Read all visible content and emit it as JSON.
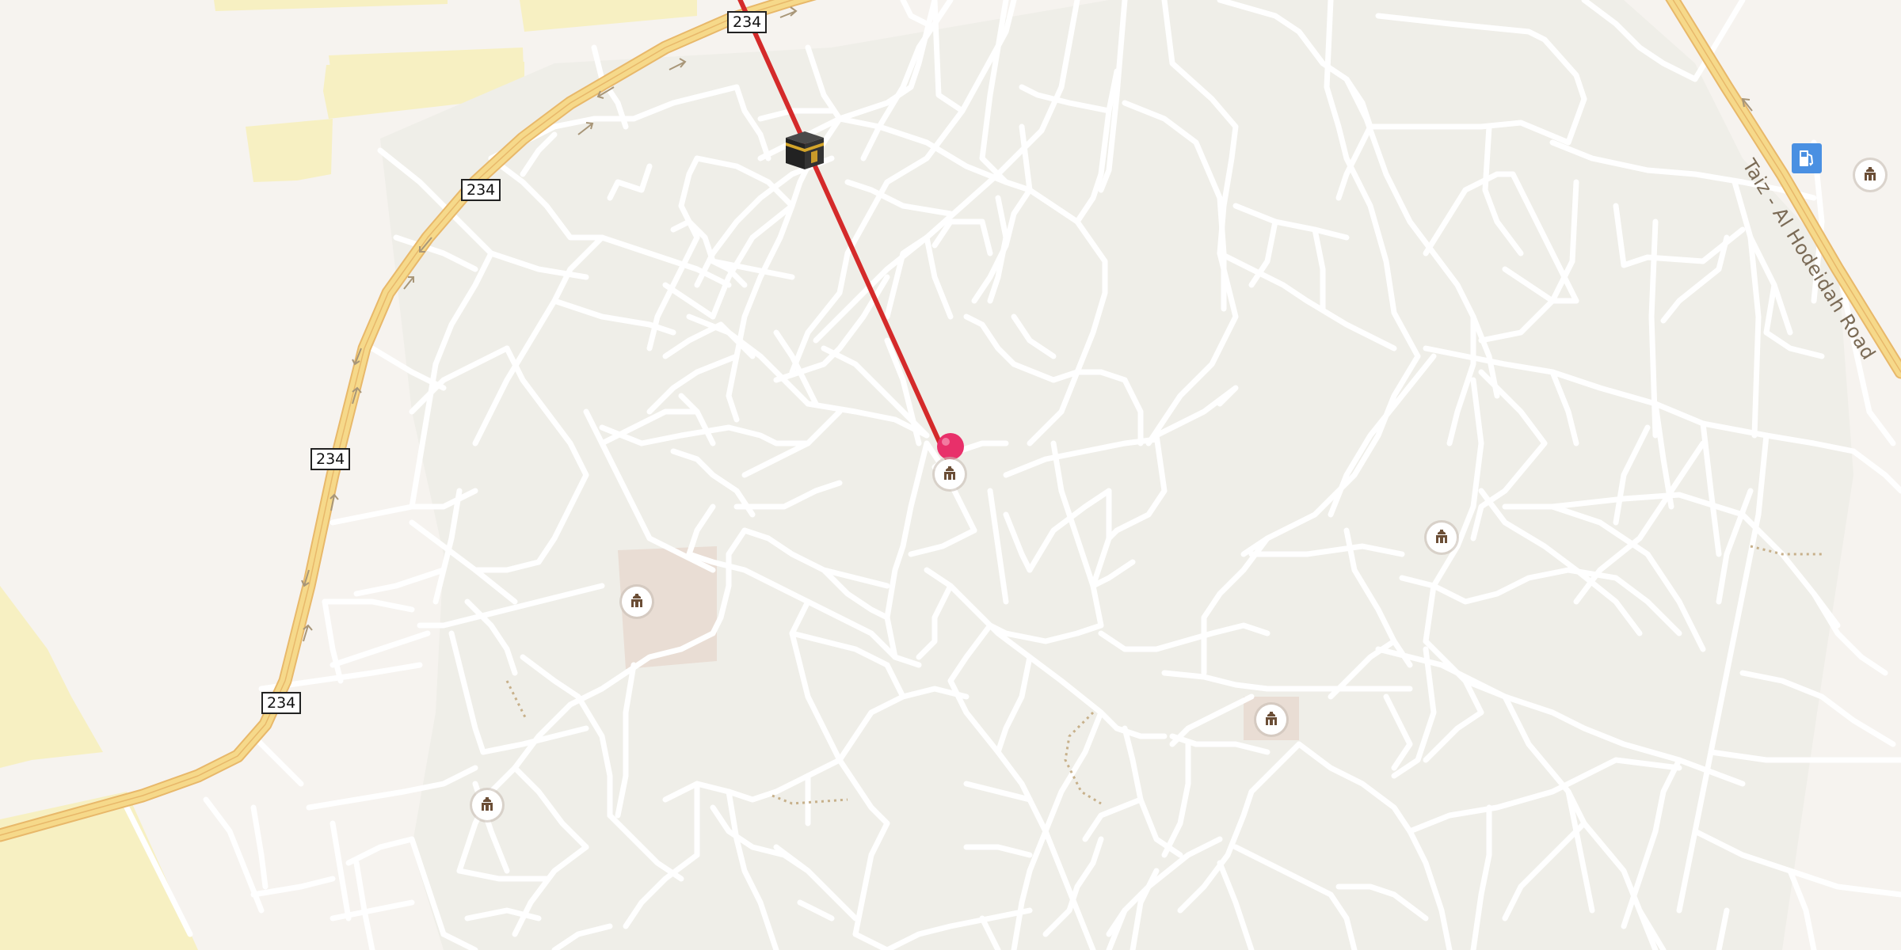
{
  "map": {
    "road_shields": [
      "234",
      "234",
      "234",
      "234"
    ],
    "road_name": "Taiz - Al Hodeidah Road",
    "icons": {
      "kaaba": "kaaba-icon",
      "location_pin": "location-pin-icon",
      "mosque": "mosque-icon",
      "fuel": "fuel-station-icon"
    },
    "colors": {
      "background": "#f6f3ef",
      "urban_area": "#efeee8",
      "street": "#ffffff",
      "primary_road": "#f6d98a",
      "primary_road_casing": "#e8b86a",
      "sand_area": "#f7f0c2",
      "qibla_line": "#d42a2a",
      "pin": "#e8306a",
      "fuel_station": "#4a90e2"
    }
  }
}
